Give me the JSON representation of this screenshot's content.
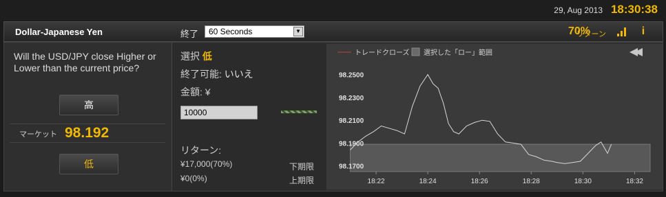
{
  "top": {
    "date": "29, Aug 2013",
    "time": "18:30:38"
  },
  "header": {
    "pair": "Dollar-Japanese Yen",
    "expiry_label": "終了",
    "expiry_value": "60 Seconds",
    "payout": "70%",
    "payout_label": "リターン"
  },
  "left": {
    "question": "Will the USD/JPY close Higher or Lower than the current price?",
    "high_button": "高",
    "market_label": "マーケット",
    "market_value": "98.192",
    "low_button": "低"
  },
  "middle": {
    "selection_label": "選択",
    "selection_value": "低",
    "closable_label": "終了可能:",
    "closable_value": "いいえ",
    "amount_label": "金額:",
    "amount_currency": "¥",
    "amount_value": "10000",
    "return_label": "リターン:",
    "return_win": "¥17,000(70%)",
    "return_lose": "¥0(0%)",
    "lower_limit_label": "下期限",
    "upper_limit_label": "上期限"
  },
  "chart_data": {
    "type": "line",
    "legend": [
      "トレードクローズ",
      "選択した「ロー」範囲"
    ],
    "x_ticks": [
      "18:22",
      "18:24",
      "18:26",
      "18:28",
      "18:30",
      "18:32"
    ],
    "y_ticks": [
      "98.2500",
      "98.2300",
      "98.2100",
      "98.1900",
      "98.1700"
    ],
    "ylim": [
      98.165,
      98.26
    ],
    "selected_low_range": [
      98.165,
      98.189
    ],
    "series": [
      {
        "x": [
          0,
          0.3,
          0.6,
          0.9,
          1.2,
          1.5,
          1.8,
          2.1,
          2.4,
          2.7,
          3.0,
          3.2,
          3.4,
          3.6,
          3.8,
          4.0,
          4.2,
          4.5,
          4.8,
          5.1,
          5.4,
          5.7,
          6.0,
          6.3,
          6.6,
          6.9,
          7.2,
          7.5,
          7.8,
          8.0,
          8.3,
          8.6,
          8.9,
          9.2,
          9.5,
          9.7,
          9.8,
          9.95,
          10.1
        ],
        "y": [
          98.184,
          98.191,
          98.196,
          98.2,
          98.205,
          98.203,
          98.201,
          98.198,
          98.222,
          98.24,
          98.25,
          98.242,
          98.238,
          98.225,
          98.207,
          98.2,
          98.198,
          98.205,
          98.208,
          98.21,
          98.209,
          98.198,
          98.191,
          98.19,
          98.189,
          98.18,
          98.178,
          98.175,
          98.174,
          98.173,
          98.172,
          98.173,
          98.174,
          98.181,
          98.188,
          98.191,
          98.187,
          98.181,
          98.189
        ]
      }
    ]
  }
}
